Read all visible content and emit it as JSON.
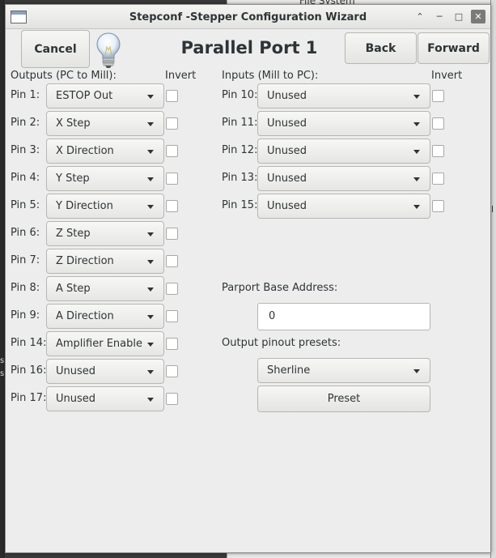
{
  "background": {
    "other_window_title": "File System",
    "left_glyphs": [
      "s",
      "s"
    ],
    "right_glyph": "l"
  },
  "window": {
    "title": "Stepconf -Stepper Configuration Wizard",
    "titlebar_buttons": {
      "up": "⌃",
      "minimize": "─",
      "maximize": "□",
      "close": "✕"
    }
  },
  "header": {
    "cancel_label": "Cancel",
    "page_title": "Parallel Port 1",
    "back_label": "Back",
    "forward_label": "Forward",
    "icon": "lightbulb-icon"
  },
  "outputs": {
    "heading": "Outputs (PC to Mill):",
    "invert_heading": "Invert",
    "pins": [
      {
        "label": "Pin 1:",
        "value": "ESTOP Out"
      },
      {
        "label": "Pin 2:",
        "value": "X Step"
      },
      {
        "label": "Pin 3:",
        "value": "X Direction"
      },
      {
        "label": "Pin 4:",
        "value": "Y Step"
      },
      {
        "label": "Pin 5:",
        "value": "Y Direction"
      },
      {
        "label": "Pin 6:",
        "value": "Z Step"
      },
      {
        "label": "Pin 7:",
        "value": "Z Direction"
      },
      {
        "label": "Pin 8:",
        "value": "A Step"
      },
      {
        "label": "Pin 9:",
        "value": "A Direction"
      },
      {
        "label": "Pin 14:",
        "value": "Amplifier Enable"
      },
      {
        "label": "Pin 16:",
        "value": "Unused"
      },
      {
        "label": "Pin 17:",
        "value": "Unused"
      }
    ]
  },
  "inputs": {
    "heading": "Inputs (Mill to PC):",
    "invert_heading": "Invert",
    "pins": [
      {
        "label": "Pin 10:",
        "value": "Unused"
      },
      {
        "label": "Pin 11:",
        "value": "Unused"
      },
      {
        "label": "Pin 12:",
        "value": "Unused"
      },
      {
        "label": "Pin 13:",
        "value": "Unused"
      },
      {
        "label": "Pin 15:",
        "value": "Unused"
      }
    ]
  },
  "parport": {
    "label": "Parport Base Address:",
    "value": "0"
  },
  "presets": {
    "label": "Output pinout presets:",
    "selected": "Sherline",
    "preset_button": "Preset"
  }
}
